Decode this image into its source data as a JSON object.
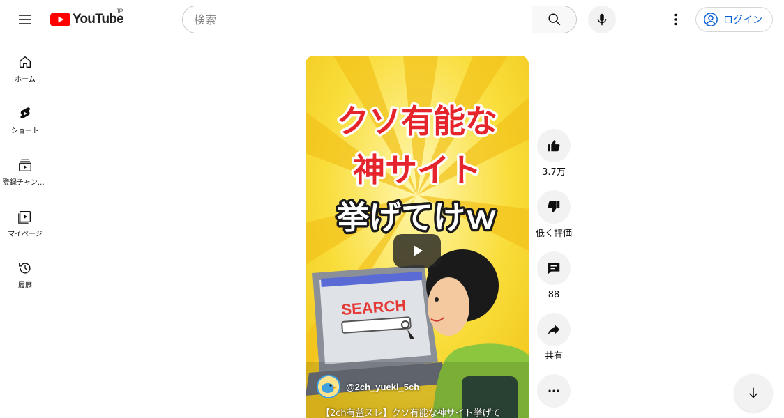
{
  "header": {
    "logo_text": "YouTube",
    "country_code": "JP",
    "search_placeholder": "検索",
    "login_label": "ログイン"
  },
  "sidebar": {
    "items": [
      {
        "label": "ホーム",
        "icon": "home-icon"
      },
      {
        "label": "ショート",
        "icon": "shorts-icon"
      },
      {
        "label": "登録チャンネル",
        "icon": "subscriptions-icon"
      },
      {
        "label": "マイページ",
        "icon": "library-icon"
      },
      {
        "label": "履歴",
        "icon": "history-icon"
      }
    ]
  },
  "short": {
    "thumbnail_text": [
      "クソ有能な",
      "神サイト",
      "挙げてけｗ"
    ],
    "thumbnail_search_word": "SEARCH",
    "channel_handle": "@2ch_yueki_5ch",
    "title": "【2ch有益スレ】クソ有能な神サイト挙げて"
  },
  "actions": {
    "like_count": "3.7万",
    "dislike_label": "低く評価",
    "comment_count": "88",
    "share_label": "共有"
  },
  "colors": {
    "brand_red": "#ff0000",
    "link_blue": "#065fd4",
    "thumb_yellow": "#f7d62e",
    "thumb_text_red": "#e5242b"
  }
}
